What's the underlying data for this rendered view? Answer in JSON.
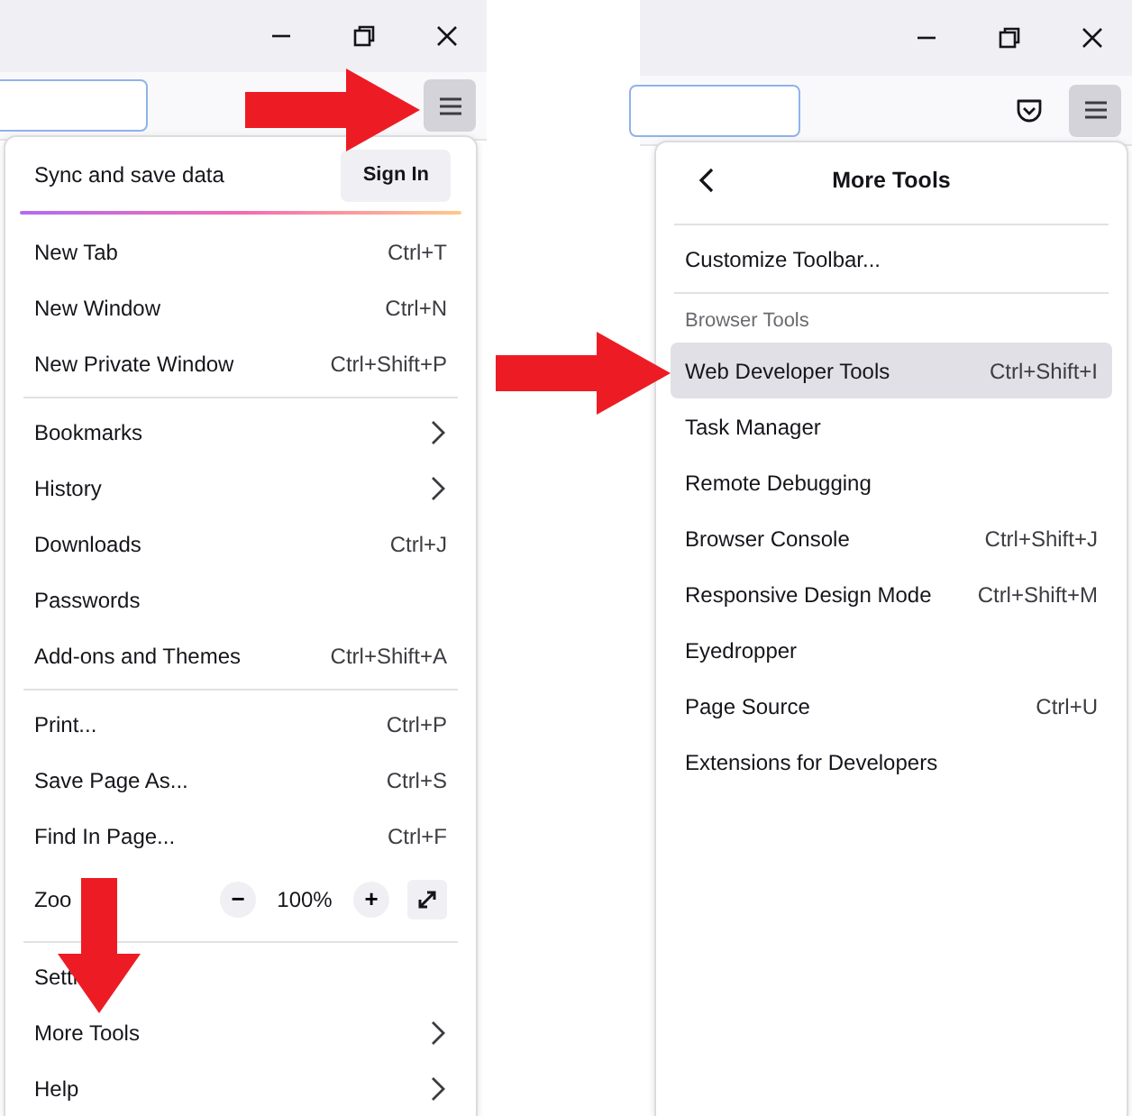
{
  "panels": [
    {
      "menu_button": {
        "pressed": true
      },
      "menu": {
        "sync": {
          "label": "Sync and save data",
          "button": "Sign In"
        },
        "items": [
          {
            "kind": "item",
            "label": "New Tab",
            "shortcut": "Ctrl+T",
            "selected": false
          },
          {
            "kind": "item",
            "label": "New Window",
            "shortcut": "Ctrl+N",
            "selected": false
          },
          {
            "kind": "item",
            "label": "New Private Window",
            "shortcut": "Ctrl+Shift+P",
            "selected": false
          },
          {
            "kind": "separator"
          },
          {
            "kind": "item",
            "label": "Bookmarks",
            "submenu": true,
            "selected": false
          },
          {
            "kind": "item",
            "label": "History",
            "submenu": true,
            "selected": false
          },
          {
            "kind": "item",
            "label": "Downloads",
            "shortcut": "Ctrl+J",
            "selected": false
          },
          {
            "kind": "item",
            "label": "Passwords",
            "selected": false
          },
          {
            "kind": "item",
            "label": "Add-ons and Themes",
            "shortcut": "Ctrl+Shift+A",
            "selected": false
          },
          {
            "kind": "separator"
          },
          {
            "kind": "item",
            "label": "Print...",
            "shortcut": "Ctrl+P",
            "selected": false
          },
          {
            "kind": "item",
            "label": "Save Page As...",
            "shortcut": "Ctrl+S",
            "selected": false
          },
          {
            "kind": "item",
            "label": "Find In Page...",
            "shortcut": "Ctrl+F",
            "selected": false
          },
          {
            "kind": "zoom",
            "label": "Zoo",
            "minus": "−",
            "value": "100%",
            "plus": "+"
          },
          {
            "kind": "separator"
          },
          {
            "kind": "item",
            "label": "Setti",
            "selected": false
          },
          {
            "kind": "item",
            "label": "More Tools",
            "submenu": true,
            "selected": false
          },
          {
            "kind": "item",
            "label": "Help",
            "submenu": true,
            "selected": false
          }
        ]
      }
    },
    {
      "menu_button": {
        "pressed": true
      },
      "pocket_button": true,
      "menu": {
        "title": "More Tools",
        "items": [
          {
            "kind": "item",
            "label": "Customize Toolbar...",
            "selected": false
          },
          {
            "kind": "separator"
          },
          {
            "kind": "heading",
            "label": "Browser Tools"
          },
          {
            "kind": "item",
            "label": "Web Developer Tools",
            "shortcut": "Ctrl+Shift+I",
            "selected": true
          },
          {
            "kind": "item",
            "label": "Task Manager",
            "selected": false
          },
          {
            "kind": "item",
            "label": "Remote Debugging",
            "selected": false
          },
          {
            "kind": "item",
            "label": "Browser Console",
            "shortcut": "Ctrl+Shift+J",
            "selected": false
          },
          {
            "kind": "item",
            "label": "Responsive Design Mode",
            "shortcut": "Ctrl+Shift+M",
            "selected": false
          },
          {
            "kind": "item",
            "label": "Eyedropper",
            "selected": false
          },
          {
            "kind": "item",
            "label": "Page Source",
            "shortcut": "Ctrl+U",
            "selected": false
          },
          {
            "kind": "item",
            "label": "Extensions for Developers",
            "selected": false
          }
        ]
      }
    }
  ],
  "arrows": [
    {
      "kind": "right"
    },
    {
      "kind": "right"
    },
    {
      "kind": "down"
    }
  ]
}
